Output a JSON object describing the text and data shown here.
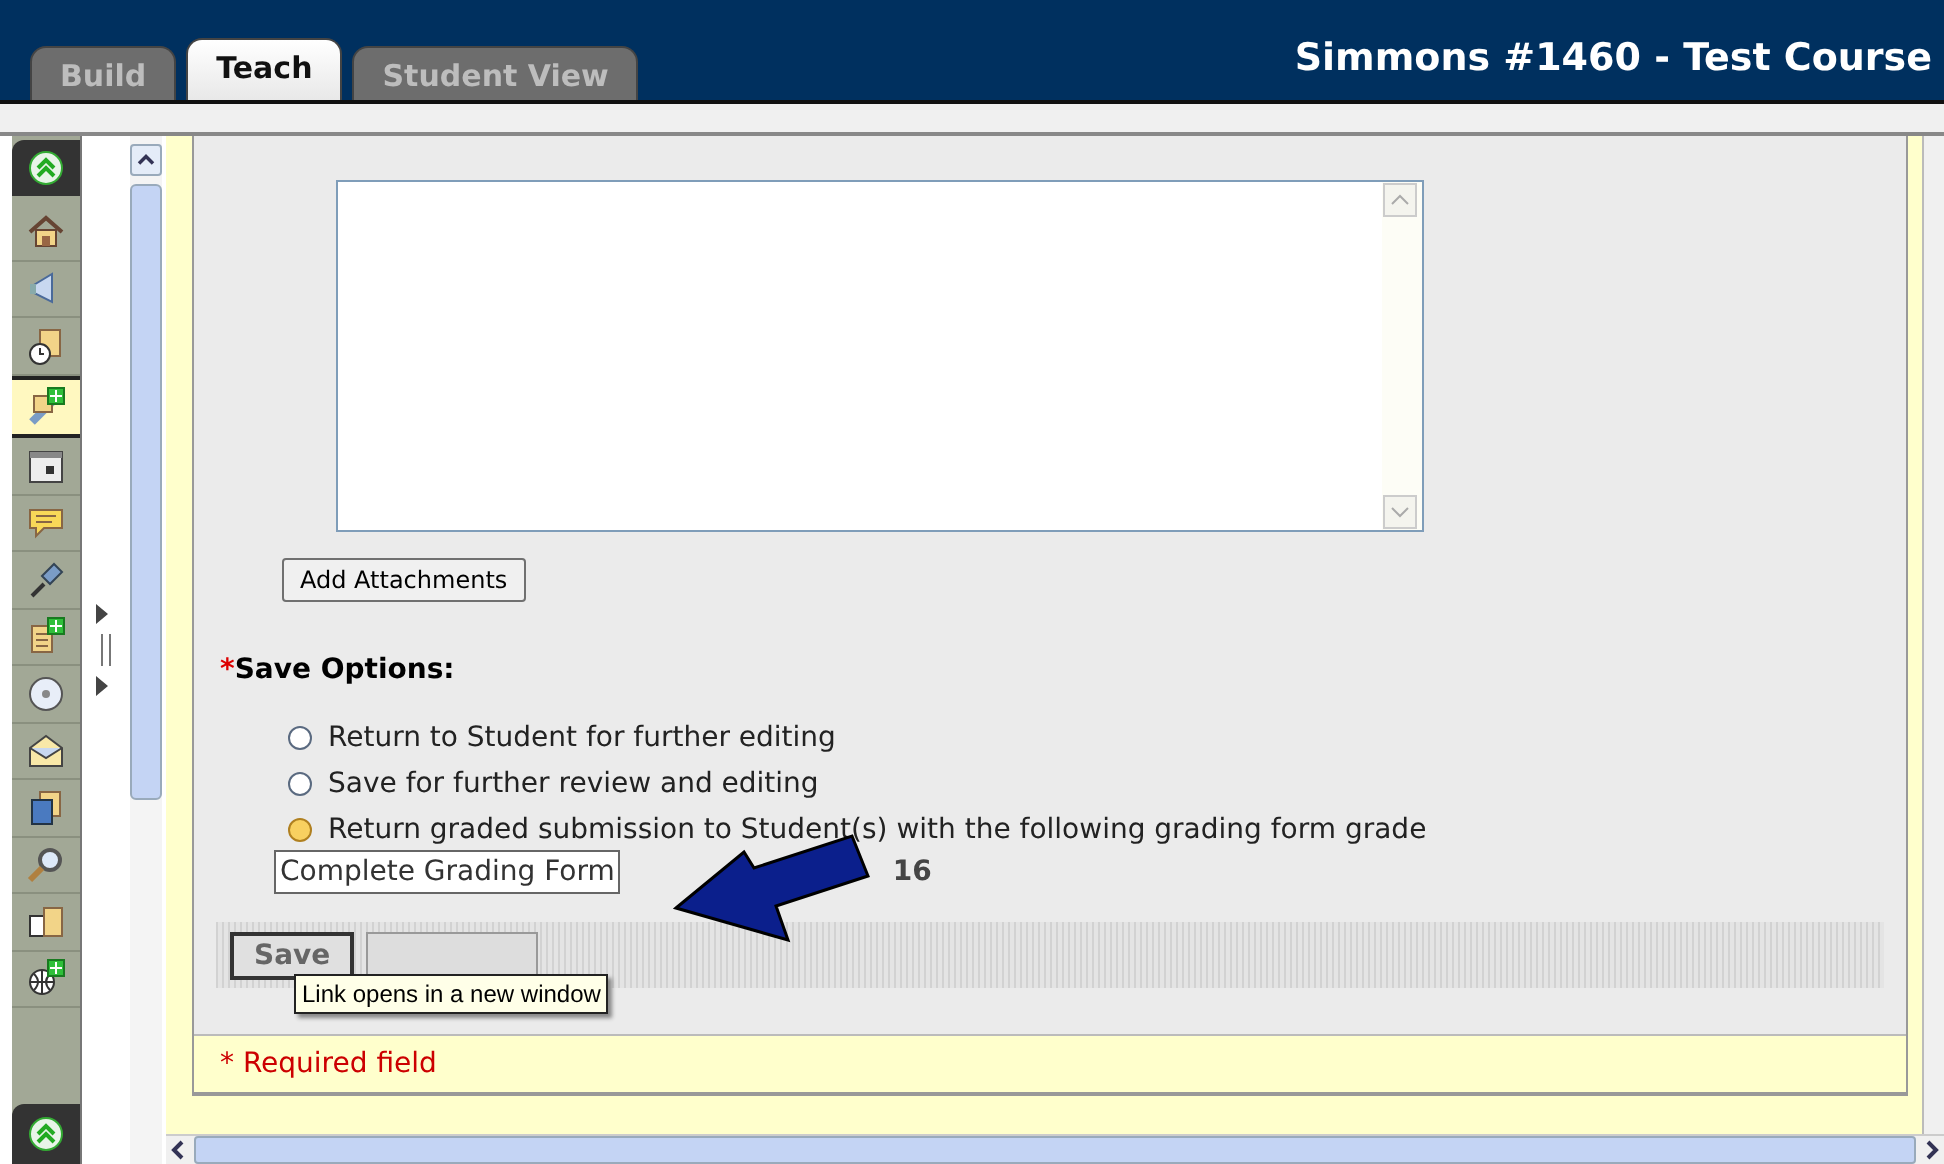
{
  "header": {
    "tabs": [
      {
        "label": "Build",
        "selected": false
      },
      {
        "label": "Teach",
        "selected": true
      },
      {
        "label": "Student View",
        "selected": false
      }
    ],
    "course_title": "Simmons #1460 - Test Course"
  },
  "toolbar": {
    "items": [
      {
        "selected": false
      },
      {
        "selected": false
      },
      {
        "selected": false
      },
      {
        "selected": true
      },
      {
        "selected": false
      },
      {
        "selected": false
      },
      {
        "selected": false
      },
      {
        "selected": false
      },
      {
        "selected": false
      },
      {
        "selected": false
      },
      {
        "selected": false
      },
      {
        "selected": false
      },
      {
        "selected": false
      },
      {
        "selected": false
      }
    ]
  },
  "form": {
    "attach_button": "Add Attachments",
    "save_options": {
      "required_mark": "*",
      "label": "Save Options:",
      "options": [
        {
          "label": "Return to Student for further editing",
          "selected": false,
          "highlighted": false
        },
        {
          "label": "Save for further review and editing",
          "selected": false,
          "highlighted": false
        },
        {
          "label": "Return graded submission to Student(s) with the following grading form grade",
          "selected": false,
          "highlighted": true
        }
      ]
    },
    "grading_form_link": "Complete Grading Form",
    "grade_suffix": "16",
    "buttons": [
      "Save"
    ],
    "tooltip": "Link opens in a new window",
    "required_note": "* Required field"
  }
}
